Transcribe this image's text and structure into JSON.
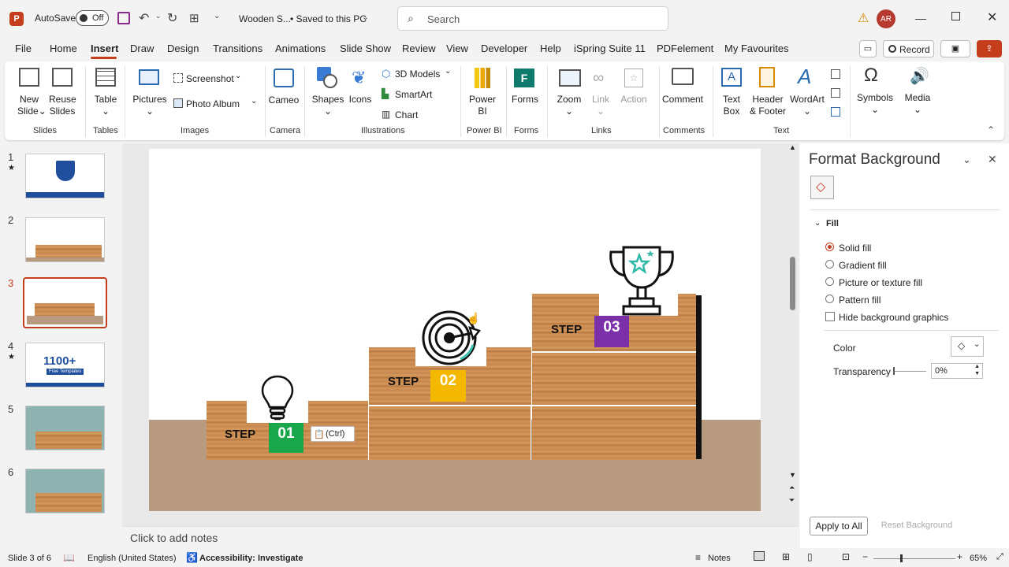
{
  "titlebar": {
    "autosave_label": "AutoSave",
    "autosave_state": "Off",
    "filename": "Wooden S...",
    "save_status": "• Saved to this PC",
    "search_placeholder": "Search",
    "user_initials": "AR"
  },
  "menu": {
    "items": [
      "File",
      "Home",
      "Insert",
      "Draw",
      "Design",
      "Transitions",
      "Animations",
      "Slide Show",
      "Review",
      "View",
      "Developer",
      "Help",
      "iSpring Suite 11",
      "PDFelement",
      "My Favourites"
    ],
    "active": "Insert",
    "record_label": "Record"
  },
  "ribbon": {
    "new_slide": "New Slide",
    "new_slide_l1": "New",
    "new_slide_l2": "Slide",
    "reuse_l1": "Reuse",
    "reuse_l2": "Slides",
    "table": "Table",
    "pictures": "Pictures",
    "screenshot": "Screenshot",
    "photo_album": "Photo Album",
    "cameo": "Cameo",
    "shapes": "Shapes",
    "icons": "Icons",
    "models_3d": "3D Models",
    "smartart": "SmartArt",
    "chart": "Chart",
    "powerbi_l1": "Power",
    "powerbi_l2": "BI",
    "forms": "Forms",
    "zoom": "Zoom",
    "link": "Link",
    "action": "Action",
    "comment": "Comment",
    "textbox_l1": "Text",
    "textbox_l2": "Box",
    "header_l1": "Header",
    "header_l2": "& Footer",
    "wordart": "WordArt",
    "symbols": "Symbols",
    "media": "Media",
    "groups": {
      "slides": "Slides",
      "tables": "Tables",
      "images": "Images",
      "camera": "Camera",
      "illustrations": "Illustrations",
      "powerbi": "Power BI",
      "forms": "Forms",
      "links": "Links",
      "comments": "Comments",
      "text": "Text"
    }
  },
  "thumbnails": {
    "numbers": [
      "1",
      "2",
      "3",
      "4",
      "5",
      "6"
    ],
    "selected": "3",
    "thumb4_text": "1100+",
    "thumb4_sub": "Free Templates"
  },
  "slide": {
    "step_label": "STEP",
    "steps": [
      {
        "num": "01",
        "color": "#1aa64a"
      },
      {
        "num": "02",
        "color": "#f5b800"
      },
      {
        "num": "03",
        "color": "#7b2fa8"
      }
    ],
    "paste_tag": "(Ctrl)"
  },
  "notes_placeholder": "Click to add notes",
  "format_pane": {
    "title": "Format Background",
    "section": "Fill",
    "options": [
      "Solid fill",
      "Gradient fill",
      "Picture or texture fill",
      "Pattern fill"
    ],
    "selected_option": "Solid fill",
    "hide_bg": "Hide background graphics",
    "color_label": "Color",
    "transparency_label": "Transparency",
    "transparency_value": "0%",
    "apply_all": "Apply to All",
    "reset": "Reset Background"
  },
  "status": {
    "slide_info": "Slide 3 of 6",
    "language": "English (United States)",
    "accessibility": "Accessibility: Investigate",
    "notes": "Notes",
    "zoom": "65%"
  },
  "colors": {
    "accent": "#c43e1c",
    "floor": "#b89a80"
  }
}
